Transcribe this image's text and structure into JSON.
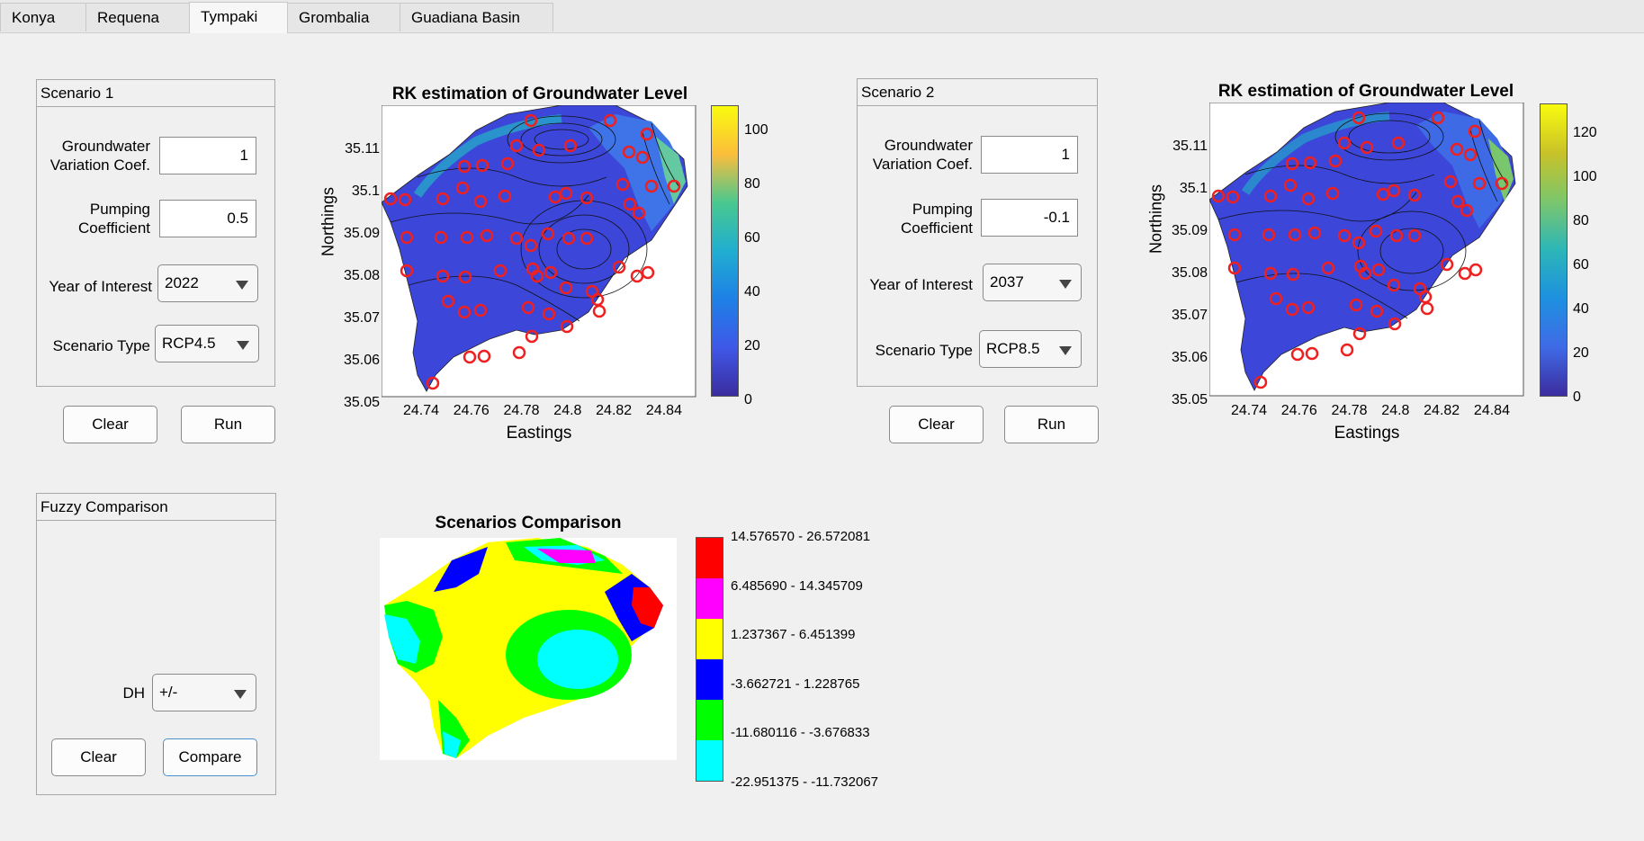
{
  "tabs": [
    {
      "label": "Konya"
    },
    {
      "label": "Requena"
    },
    {
      "label": "Tympaki",
      "active": true
    },
    {
      "label": "Grombalia"
    },
    {
      "label": "Guadiana Basin"
    }
  ],
  "scenario1": {
    "title": "Scenario 1",
    "gw_label_1": "Groundwater",
    "gw_label_2": "Variation Coef.",
    "gw_value": "1",
    "pump_label_1": "Pumping",
    "pump_label_2": "Coefficient",
    "pump_value": "0.5",
    "year_label": "Year of Interest",
    "year_value": "2022",
    "type_label": "Scenario Type",
    "type_value": "RCP4.5",
    "clear_label": "Clear",
    "run_label": "Run"
  },
  "scenario2": {
    "title": "Scenario 2",
    "gw_label_1": "Groundwater",
    "gw_label_2": "Variation Coef.",
    "gw_value": "1",
    "pump_label_1": "Pumping",
    "pump_label_2": "Coefficient",
    "pump_value": "-0.1",
    "year_label": "Year of Interest",
    "year_value": "2037",
    "type_label": "Scenario Type",
    "type_value": "RCP8.5",
    "clear_label": "Clear",
    "run_label": "Run"
  },
  "fuzzy": {
    "title": "Fuzzy Comparison",
    "dh_label": "DH",
    "dh_value": "+/-",
    "clear_label": "Clear",
    "compare_label": "Compare"
  },
  "plot1": {
    "title": "RK estimation of Groundwater Level",
    "xlabel": "Eastings",
    "ylabel": "Northings",
    "xticks": [
      "24.74",
      "24.76",
      "24.78",
      "24.8",
      "24.82",
      "24.84"
    ],
    "yticks": [
      "35.11",
      "35.1",
      "35.09",
      "35.08",
      "35.07",
      "35.06",
      "35.05"
    ],
    "colorbar_ticks": [
      "100",
      "80",
      "60",
      "40",
      "20",
      "0"
    ]
  },
  "plot2": {
    "title": "RK estimation of Groundwater Level",
    "xlabel": "Eastings",
    "ylabel": "Northings",
    "xticks": [
      "24.74",
      "24.76",
      "24.78",
      "24.8",
      "24.82",
      "24.84"
    ],
    "yticks": [
      "35.11",
      "35.1",
      "35.09",
      "35.08",
      "35.07",
      "35.06",
      "35.05"
    ],
    "colorbar_ticks": [
      "120",
      "100",
      "80",
      "60",
      "40",
      "20",
      "0"
    ]
  },
  "comparison": {
    "title": "Scenarios Comparison",
    "legend": [
      {
        "label": "14.576570 - 26.572081",
        "color": "#ff0000"
      },
      {
        "label": "6.485690 - 14.345709",
        "color": "#ff00ff"
      },
      {
        "label": "1.237367 - 6.451399",
        "color": "#ffff00"
      },
      {
        "label": "-3.662721 - 1.228765",
        "color": "#0000ff"
      },
      {
        "label": "-11.680116 - -3.676833",
        "color": "#00ff00"
      },
      {
        "label": "-22.951375 - -11.732067",
        "color": "#00ffff"
      }
    ]
  }
}
